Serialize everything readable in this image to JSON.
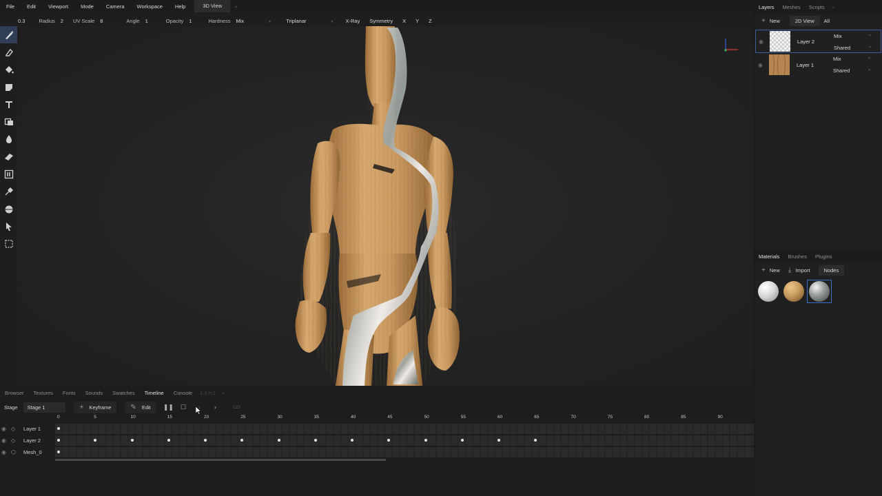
{
  "menu": {
    "items": [
      "File",
      "Edit",
      "Viewport",
      "Mode",
      "Camera",
      "Workspace",
      "Help"
    ],
    "active_tab": "3D View",
    "extra": "+"
  },
  "toolbar": {
    "size_value": "0.3",
    "radius_label": "Radius",
    "radius_value": "2",
    "uvscale_label": "UV Scale",
    "uvscale_value": "8",
    "angle_label": "Angle",
    "angle_value": "1",
    "opacity_label": "Opacity",
    "opacity_value": "1",
    "hardness_label": "Hardness",
    "hardness_value": "Mix",
    "projection": "Triplanar",
    "xray": "X-Ray",
    "symmetry": "Symmetry",
    "x": "X",
    "y": "Y",
    "z": "Z"
  },
  "tools": [
    "brush-icon",
    "eraser-icon",
    "fill-icon",
    "decal-icon",
    "text-icon",
    "clone-icon",
    "blur-icon",
    "smudge-icon",
    "particle-icon",
    "picker-icon",
    "bake-icon",
    "select-icon",
    "marquee-icon"
  ],
  "layers_panel": {
    "tabs": [
      "Layers",
      "Meshes",
      "Scripts"
    ],
    "extra": "+",
    "new_label": "New",
    "view_label": "2D View",
    "filter_label": "All",
    "layers": [
      {
        "name": "Layer 2",
        "blend": "Mix",
        "mode": "Shared"
      },
      {
        "name": "Layer 1",
        "blend": "Mix",
        "mode": "Shared"
      }
    ]
  },
  "materials_panel": {
    "tabs": [
      "Materials",
      "Brushes",
      "Plugins"
    ],
    "new_label": "New",
    "import_label": "Import",
    "nodes_label": "Nodes",
    "swatch_colors": [
      "#d9d9d9",
      "#c79a5e",
      "#8a8f8c"
    ]
  },
  "bottom_panel": {
    "tabs": [
      "Browser",
      "Textures",
      "Fonts",
      "Sounds",
      "Swatches",
      "Timeline",
      "Console"
    ],
    "version": "1.0 rc1",
    "extra": "+",
    "active_tab": "Timeline"
  },
  "timeline": {
    "stage_label": "Stage",
    "stage_value": "Stage 1",
    "keyframe_label": "Keyframe",
    "edit_label": "Edit",
    "frame_display": "123",
    "ticks": [
      "0",
      "5",
      "10",
      "15",
      "20",
      "25",
      "30",
      "35",
      "40",
      "45",
      "50",
      "55",
      "60",
      "65",
      "70",
      "75",
      "80",
      "85",
      "90"
    ],
    "tracks": [
      {
        "name": "Layer 1",
        "keys": [
          0
        ]
      },
      {
        "name": "Layer 2",
        "keys": [
          0,
          5,
          10,
          15,
          20,
          25,
          30,
          35,
          40,
          45,
          50,
          55,
          60,
          65
        ]
      },
      {
        "name": "Mesh_0",
        "keys": [
          0
        ]
      }
    ]
  },
  "colors": {
    "accent": "#3f5f9e",
    "background": "#1e1e1e",
    "wood": "#c79a5e"
  }
}
